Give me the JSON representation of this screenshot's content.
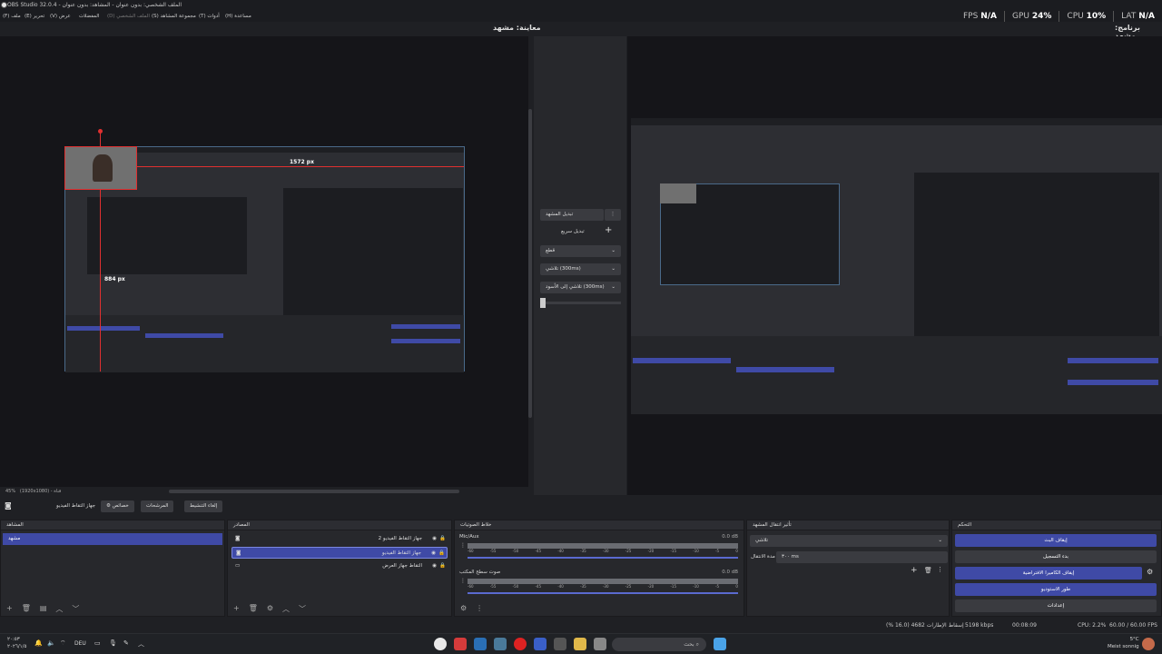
{
  "window": {
    "title": "OBS Studio 32.0.4 - الملف الشخصي: بدون عنوان - المشاهد: بدون عنوان"
  },
  "menu": [
    "(F) ملف",
    "(E) تحرير",
    "(V) عرض",
    "المفضلات",
    "(D) الملف الشخصي",
    "(S) مجموعة المشاهد",
    "(T) أدوات",
    "(H) مساعدة"
  ],
  "stats": {
    "fps_label": "FPS",
    "fps": "N/A",
    "gpu_label": "GPU",
    "gpu": "24%",
    "cpu_label": "CPU",
    "cpu": "10%",
    "lat_label": "LAT",
    "lat": "N/A"
  },
  "preview": {
    "label": "معاينة: مشهد",
    "zoom": "45%",
    "dims_1": "1572 px",
    "dims_2": "884 px",
    "canvas_info": "(1920x1080) - قناة"
  },
  "program": {
    "label": "برنامج: مشهد"
  },
  "transitions_mid": {
    "scene_btn": "تبديل المشهد",
    "quick": "تبديل سريع",
    "t1": "قطع",
    "t2": "تلاشي (300ms)",
    "t3": "تلاشي إلى الأسود (300ms)"
  },
  "toolbar": {
    "source_name": "جهاز التقاط الفيديو",
    "props": "خصائص",
    "filters": "المرشحات",
    "deactivate": "إلغاء التنشيط"
  },
  "scenes": {
    "title": "المشاهد",
    "items": [
      "مشهد"
    ]
  },
  "sources": {
    "title": "المصادر",
    "items": [
      {
        "name": "جهاز التقاط الفيديو 2",
        "selected": false
      },
      {
        "name": "جهاز التقاط الفيديو",
        "selected": true
      },
      {
        "name": "التقاط جهاز العرض",
        "selected": false
      }
    ]
  },
  "mixer": {
    "title": "خلاط الصوتيات",
    "ch1": {
      "name": "Mic/Aux",
      "db": "0.0 dB"
    },
    "ch2": {
      "name": "صوت سطح المكتب",
      "db": "0.0 dB"
    },
    "ticks": [
      "-60",
      "-55",
      "-50",
      "-45",
      "-40",
      "-35",
      "-30",
      "-25",
      "-20",
      "-15",
      "-10",
      "-5",
      "0"
    ]
  },
  "scene_transitions": {
    "title": "تأثير انتقال المشهد",
    "type": "تلاشي",
    "duration_label": "مدة الانتقال",
    "duration": "٣٠٠ ms"
  },
  "controls": {
    "title": "التحكم",
    "buttons": [
      "إيقاف البث",
      "بدء التسجيل",
      "إيقاف الكاميرا الافتراضية",
      "طور الاستوديو",
      "إعدادات"
    ]
  },
  "status": {
    "frames": "إسقاط الإطارات 4682 (16.0 %)",
    "bitrate": "5198 kbps",
    "time": "00:08:09",
    "cpu": "CPU: 2.2%",
    "fps": "60.00 / 60.00 FPS"
  },
  "taskbar": {
    "search": "بحث",
    "time": "٢٠:٥٣",
    "date": "٢٠٢٦/١/٥",
    "lang": "DEU",
    "weather": "5°C",
    "weather_text": "Meist sonnig"
  }
}
